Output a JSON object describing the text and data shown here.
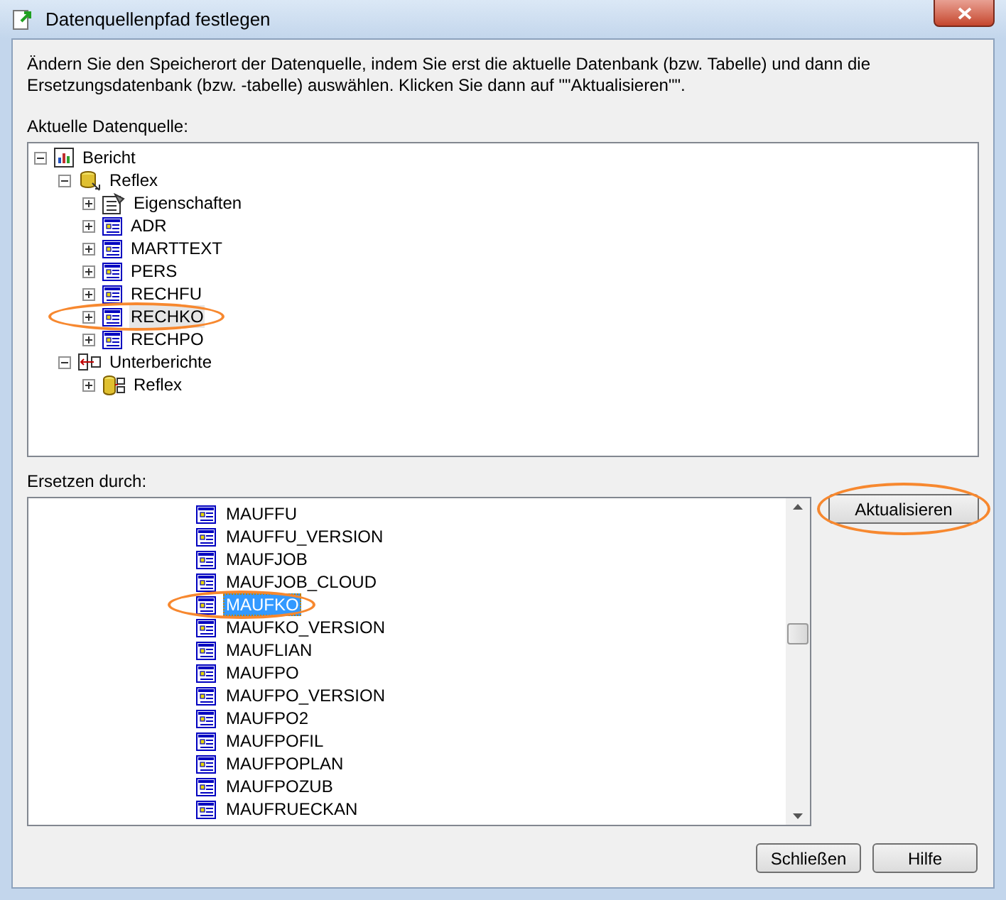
{
  "window": {
    "title": "Datenquellenpfad festlegen"
  },
  "instructions": "Ändern Sie den Speicherort der Datenquelle, indem Sie erst die aktuelle Datenbank (bzw. Tabelle) und dann die Ersetzungsdatenbank (bzw. -tabelle) auswählen. Klicken Sie dann auf \"\"Aktualisieren\"\".",
  "current_label": "Aktuelle Datenquelle:",
  "tree": [
    {
      "label": "Bericht",
      "kind": "report",
      "expanded": true,
      "selected": false,
      "circled": false,
      "children": [
        {
          "label": "Reflex",
          "kind": "database",
          "expanded": true,
          "selected": false,
          "circled": false,
          "children": [
            {
              "label": "Eigenschaften",
              "kind": "properties",
              "expanded": false,
              "selected": false,
              "circled": false
            },
            {
              "label": "ADR",
              "kind": "table",
              "expanded": false,
              "selected": false,
              "circled": false
            },
            {
              "label": "MARTTEXT",
              "kind": "table",
              "expanded": false,
              "selected": false,
              "circled": false
            },
            {
              "label": "PERS",
              "kind": "table",
              "expanded": false,
              "selected": false,
              "circled": false
            },
            {
              "label": "RECHFU",
              "kind": "table",
              "expanded": false,
              "selected": false,
              "circled": false
            },
            {
              "label": "RECHKO",
              "kind": "table",
              "expanded": false,
              "selected": true,
              "circled": true
            },
            {
              "label": "RECHPO",
              "kind": "table",
              "expanded": false,
              "selected": false,
              "circled": false
            }
          ]
        },
        {
          "label": "Unterberichte",
          "kind": "subreports",
          "expanded": true,
          "selected": false,
          "circled": false,
          "children": [
            {
              "label": "Reflex",
              "kind": "linked-database",
              "expanded": false,
              "selected": false,
              "circled": false
            }
          ]
        }
      ]
    }
  ],
  "replace_label": "Ersetzen durch:",
  "replace_list": [
    {
      "label": "MAUFFU",
      "selected": false,
      "circled": false
    },
    {
      "label": "MAUFFU_VERSION",
      "selected": false,
      "circled": false
    },
    {
      "label": "MAUFJOB",
      "selected": false,
      "circled": false
    },
    {
      "label": "MAUFJOB_CLOUD",
      "selected": false,
      "circled": false
    },
    {
      "label": "MAUFKO",
      "selected": true,
      "circled": true
    },
    {
      "label": "MAUFKO_VERSION",
      "selected": false,
      "circled": false
    },
    {
      "label": "MAUFLIAN",
      "selected": false,
      "circled": false
    },
    {
      "label": "MAUFPO",
      "selected": false,
      "circled": false
    },
    {
      "label": "MAUFPO_VERSION",
      "selected": false,
      "circled": false
    },
    {
      "label": "MAUFPO2",
      "selected": false,
      "circled": false
    },
    {
      "label": "MAUFPOFIL",
      "selected": false,
      "circled": false
    },
    {
      "label": "MAUFPOPLAN",
      "selected": false,
      "circled": false
    },
    {
      "label": "MAUFPOZUB",
      "selected": false,
      "circled": false
    },
    {
      "label": "MAUFRUECKAN",
      "selected": false,
      "circled": false
    }
  ],
  "update_button": {
    "label": "Aktualisieren",
    "circled": true
  },
  "buttons": [
    "Schließen",
    "Hilfe"
  ]
}
